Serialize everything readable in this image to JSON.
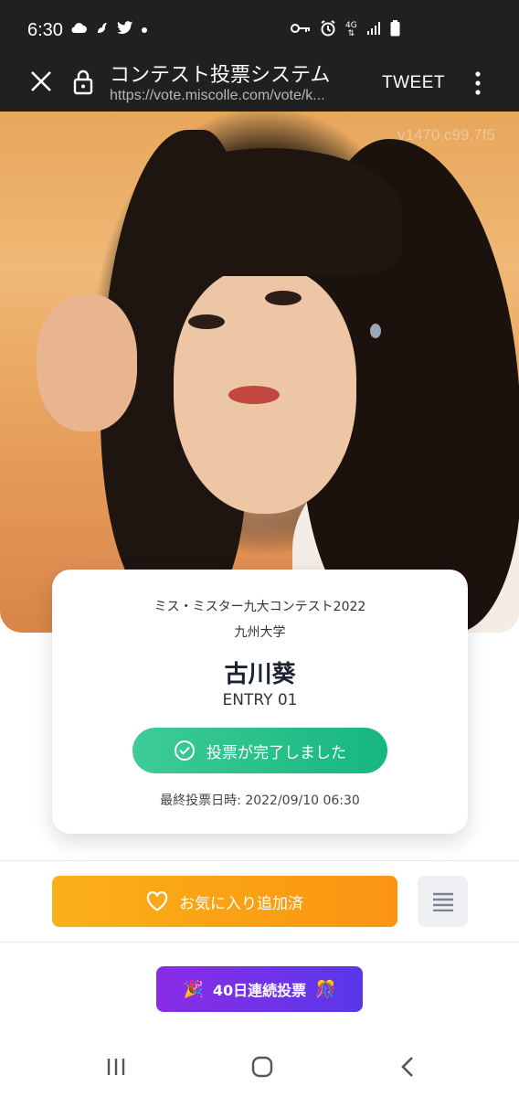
{
  "status_bar": {
    "time": "6:30",
    "left_icons": [
      "cloud-icon",
      "bird-icon",
      "twitter-icon",
      "dot-icon"
    ],
    "right_icons": [
      "key-icon",
      "alarm-icon",
      "network-4g-icon",
      "signal-icon",
      "battery-icon"
    ],
    "network_label": "4G"
  },
  "browser": {
    "title": "コンテスト投票システム",
    "url": "https://vote.miscolle.com/vote/k...",
    "tweet_label": "TWEET"
  },
  "hero": {
    "watermark": "v1470.c99.7f5"
  },
  "card": {
    "contest_name": "ミス・ミスター九大コンテスト2022",
    "university": "九州大学",
    "entrant_name": "古川葵",
    "entry_number": "ENTRY 01",
    "vote_status": "投票が完了しました",
    "last_vote": "最終投票日時: 2022/09/10 06:30"
  },
  "actions": {
    "favorite_label": "お気に入り追加済"
  },
  "streak": {
    "label": "40日連続投票",
    "emoji_left": "🎉",
    "emoji_right": "🎊"
  },
  "colors": {
    "vote_green": "#1fbd85",
    "favorite_orange": "#fba214",
    "streak_purple": "#7331e8",
    "header_dark": "#202020"
  }
}
